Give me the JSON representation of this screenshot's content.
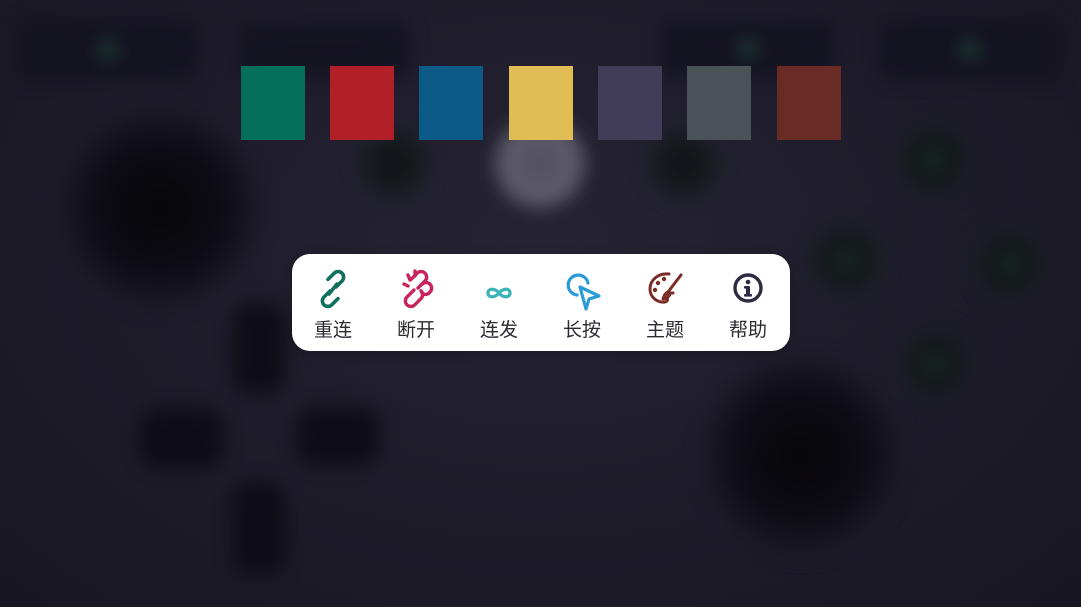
{
  "theme_swatches": [
    {
      "name": "green",
      "color": "#04705a"
    },
    {
      "name": "red",
      "color": "#b21f29"
    },
    {
      "name": "blue",
      "color": "#0b5a87"
    },
    {
      "name": "yellow",
      "color": "#e2bd55"
    },
    {
      "name": "purple",
      "color": "#413c57"
    },
    {
      "name": "slate",
      "color": "#4a5257"
    },
    {
      "name": "brown",
      "color": "#6a2a25"
    }
  ],
  "toolbar": {
    "items": [
      {
        "id": "reconnect",
        "label": "重连",
        "icon": "link-icon",
        "color": "#11705c"
      },
      {
        "id": "disconnect",
        "label": "断开",
        "icon": "broken-link-icon",
        "color": "#c8235f"
      },
      {
        "id": "turbo",
        "label": "连发",
        "icon": "infinity-icon",
        "color": "#3ab3b8"
      },
      {
        "id": "long_press",
        "label": "长按",
        "icon": "cursor-pointer-icon",
        "color": "#2a9bd6"
      },
      {
        "id": "theme",
        "label": "主题",
        "icon": "palette-icon",
        "color": "#7a2c26"
      },
      {
        "id": "help",
        "label": "帮助",
        "icon": "info-icon",
        "color": "#2e2a44"
      }
    ]
  }
}
